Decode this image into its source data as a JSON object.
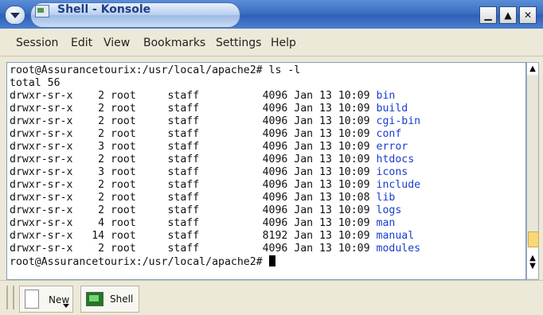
{
  "window": {
    "title": "Shell - Konsole",
    "buttons": {
      "minimize": "▁",
      "maximize": "▲",
      "close": "✕"
    }
  },
  "menu": [
    "Session",
    "Edit",
    "View",
    "Bookmarks",
    "Settings",
    "Help"
  ],
  "terminal": {
    "prompt_cmd": "root@Assurancetourix:/usr/local/apache2# ls -l",
    "total": "total 56",
    "rows": [
      {
        "perm": "drwxr-sr-x",
        "links": "2",
        "owner": "root",
        "group": "staff",
        "size": "4096",
        "date": "Jan 13 10:09",
        "name": "bin"
      },
      {
        "perm": "drwxr-sr-x",
        "links": "2",
        "owner": "root",
        "group": "staff",
        "size": "4096",
        "date": "Jan 13 10:09",
        "name": "build"
      },
      {
        "perm": "drwxr-sr-x",
        "links": "2",
        "owner": "root",
        "group": "staff",
        "size": "4096",
        "date": "Jan 13 10:09",
        "name": "cgi-bin"
      },
      {
        "perm": "drwxr-sr-x",
        "links": "2",
        "owner": "root",
        "group": "staff",
        "size": "4096",
        "date": "Jan 13 10:09",
        "name": "conf"
      },
      {
        "perm": "drwxr-sr-x",
        "links": "3",
        "owner": "root",
        "group": "staff",
        "size": "4096",
        "date": "Jan 13 10:09",
        "name": "error"
      },
      {
        "perm": "drwxr-sr-x",
        "links": "2",
        "owner": "root",
        "group": "staff",
        "size": "4096",
        "date": "Jan 13 10:09",
        "name": "htdocs"
      },
      {
        "perm": "drwxr-sr-x",
        "links": "3",
        "owner": "root",
        "group": "staff",
        "size": "4096",
        "date": "Jan 13 10:09",
        "name": "icons"
      },
      {
        "perm": "drwxr-sr-x",
        "links": "2",
        "owner": "root",
        "group": "staff",
        "size": "4096",
        "date": "Jan 13 10:09",
        "name": "include"
      },
      {
        "perm": "drwxr-sr-x",
        "links": "2",
        "owner": "root",
        "group": "staff",
        "size": "4096",
        "date": "Jan 13 10:08",
        "name": "lib"
      },
      {
        "perm": "drwxr-sr-x",
        "links": "2",
        "owner": "root",
        "group": "staff",
        "size": "4096",
        "date": "Jan 13 10:09",
        "name": "logs"
      },
      {
        "perm": "drwxr-sr-x",
        "links": "4",
        "owner": "root",
        "group": "staff",
        "size": "4096",
        "date": "Jan 13 10:09",
        "name": "man"
      },
      {
        "perm": "drwxr-sr-x",
        "links": "14",
        "owner": "root",
        "group": "staff",
        "size": "8192",
        "date": "Jan 13 10:09",
        "name": "manual"
      },
      {
        "perm": "drwxr-sr-x",
        "links": "2",
        "owner": "root",
        "group": "staff",
        "size": "4096",
        "date": "Jan 13 10:09",
        "name": "modules"
      }
    ],
    "prompt_end": "root@Assurancetourix:/usr/local/apache2# "
  },
  "tabs": {
    "new_label": "New",
    "shell_label": "Shell"
  },
  "colors": {
    "dir": "#1a3ccf",
    "titlebar": "#3b6fc2",
    "background": "#ece9d8"
  }
}
